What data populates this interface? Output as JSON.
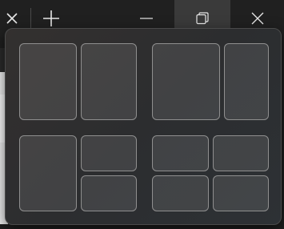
{
  "titlebar": {
    "close_tab_icon": "close-icon",
    "new_tab_icon": "plus-icon",
    "minimize_icon": "minimize-icon",
    "maximize_icon": "restore-icon",
    "close_icon": "close-icon",
    "hover_color": "#3a3a3a"
  },
  "snap_layouts": {
    "layouts": [
      {
        "id": "half-half",
        "zones": [
          "left-half",
          "right-half"
        ]
      },
      {
        "id": "two-thirds-one-third",
        "zones": [
          "left-two-thirds",
          "right-third"
        ]
      },
      {
        "id": "half-quarters",
        "zones": [
          "left-half",
          "top-right-quarter",
          "bottom-right-quarter"
        ]
      },
      {
        "id": "quarters",
        "zones": [
          "top-left",
          "top-right",
          "bottom-left",
          "bottom-right"
        ]
      }
    ],
    "zone_border_color": "#8f8f8f"
  }
}
